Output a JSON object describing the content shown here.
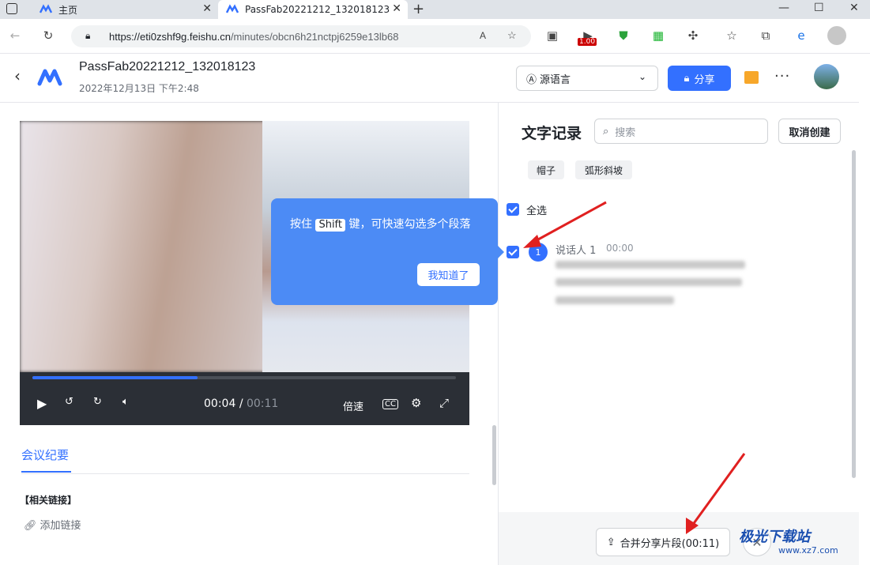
{
  "browser": {
    "tabs": [
      {
        "label": "主页"
      },
      {
        "label": "PassFab20221212_132018123"
      }
    ],
    "url_host": "https://eti0zshf9g.feishu.cn",
    "url_path": "/minutes/obcn6h21nctpj6259e13lb68",
    "extension_badge": "1.00"
  },
  "header": {
    "title": "PassFab20221212_132018123",
    "date": "2022年12月13日 下午2:48",
    "language_select": "源语言",
    "share_label": "分享"
  },
  "player": {
    "time_current": "00:04",
    "time_separator": "/",
    "time_total": "00:11",
    "speed_label": "倍速",
    "progress": 0.39
  },
  "summary": {
    "tab_label": "会议纪要",
    "related_links": "【相关链接】",
    "add_link": "添加链接"
  },
  "transcript": {
    "title": "文字记录",
    "search_placeholder": "搜索",
    "cancel_label": "取消创建",
    "tags": [
      "帽子",
      "弧形斜坡"
    ],
    "select_all": "全选",
    "speaker_index": "1",
    "speaker_name": "说话人 1",
    "speaker_time": "00:00",
    "merge_label": "合并分享片段(00:11)"
  },
  "tooltip": {
    "text_before": "按住",
    "key": "Shift",
    "text_after": "键，可快速勾选多个段落",
    "button": "我知道了"
  },
  "watermark": {
    "title": "极光下载站",
    "sub": "www.xz7.com"
  },
  "colors": {
    "accent": "#3370ff",
    "tooltip": "#4c8bf5",
    "arrow": "#e02020"
  }
}
